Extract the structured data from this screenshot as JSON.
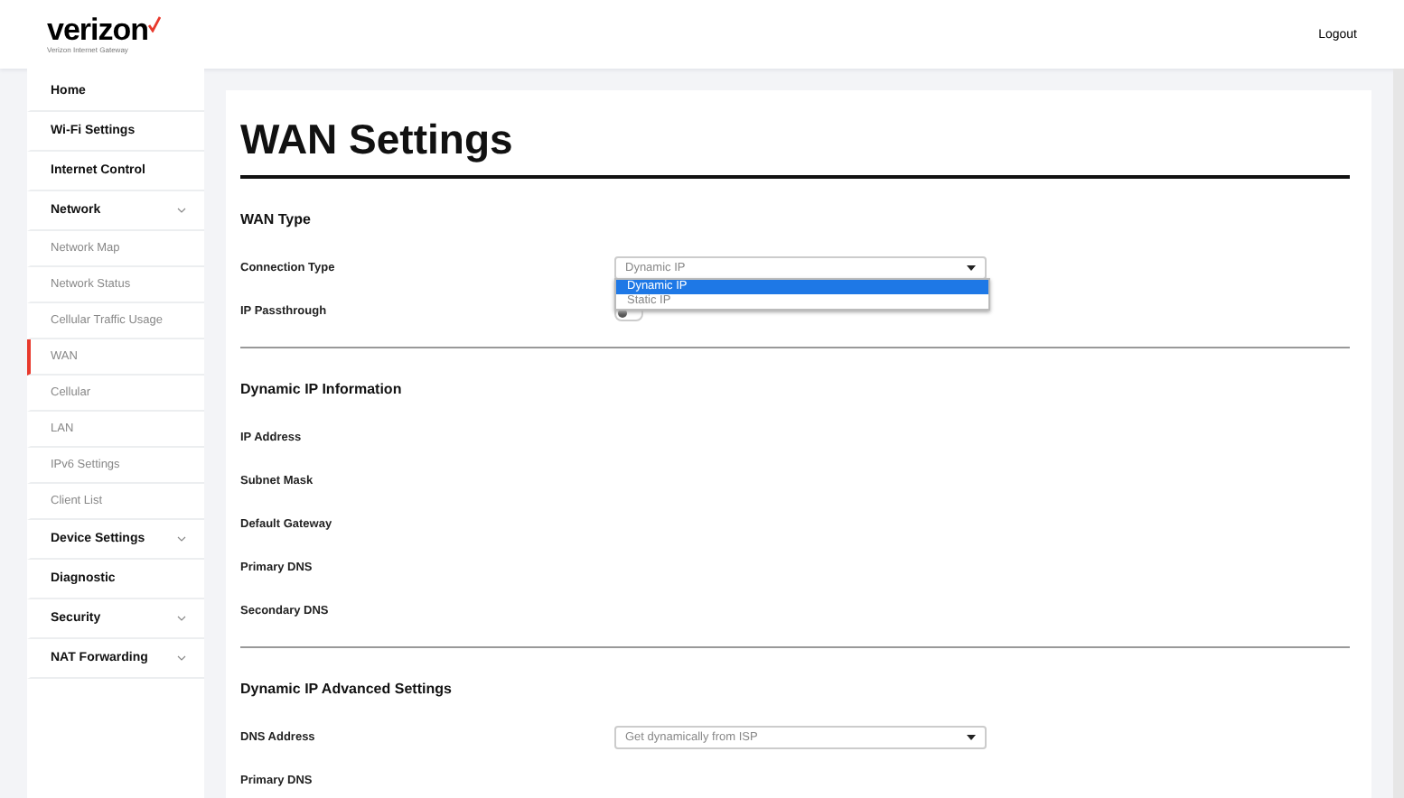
{
  "header": {
    "logo": "verizon",
    "logo_subtitle": "Verizon Internet Gateway",
    "logout": "Logout"
  },
  "sidebar": {
    "items": [
      {
        "label": "Home",
        "selected": false
      },
      {
        "label": "Wi-Fi Settings",
        "selected": false
      },
      {
        "label": "Internet Control",
        "selected": false
      },
      {
        "label": "Network",
        "selected": false,
        "has_submenu": true,
        "children": [
          {
            "label": "Network Map",
            "selected": false
          },
          {
            "label": "Network Status",
            "selected": false
          },
          {
            "label": "Cellular Traffic Usage",
            "selected": false
          },
          {
            "label": "WAN",
            "selected": true
          },
          {
            "label": "Cellular",
            "selected": false
          },
          {
            "label": "LAN",
            "selected": false
          },
          {
            "label": "IPv6 Settings",
            "selected": false
          },
          {
            "label": "Client List",
            "selected": false
          }
        ]
      },
      {
        "label": "Device Settings",
        "selected": false,
        "has_submenu": true
      },
      {
        "label": "Diagnostic",
        "selected": false
      },
      {
        "label": "Security",
        "selected": false,
        "has_submenu": true
      },
      {
        "label": "NAT Forwarding",
        "selected": false,
        "has_submenu": true
      }
    ]
  },
  "page": {
    "title": "WAN Settings",
    "sections": [
      {
        "title": "WAN Type",
        "rows": [
          {
            "kind": "select",
            "label": "Connection Type",
            "value": "Dynamic IP",
            "open": true,
            "options": [
              {
                "label": "Dynamic IP",
                "selected": true
              },
              {
                "label": "Static IP",
                "selected": false
              }
            ]
          },
          {
            "kind": "toggle",
            "label": "IP Passthrough",
            "on": false
          }
        ]
      },
      {
        "title": "Dynamic IP Information",
        "rows": [
          {
            "kind": "text",
            "label": "IP Address"
          },
          {
            "kind": "text",
            "label": "Subnet Mask"
          },
          {
            "kind": "text",
            "label": "Default Gateway"
          },
          {
            "kind": "text",
            "label": "Primary DNS"
          },
          {
            "kind": "text",
            "label": "Secondary DNS"
          }
        ]
      },
      {
        "title": "Dynamic IP Advanced Settings",
        "rows": [
          {
            "kind": "select",
            "label": "DNS Address",
            "value": "Get dynamically from ISP",
            "open": false
          },
          {
            "kind": "text",
            "label": "Primary DNS"
          }
        ]
      }
    ]
  }
}
